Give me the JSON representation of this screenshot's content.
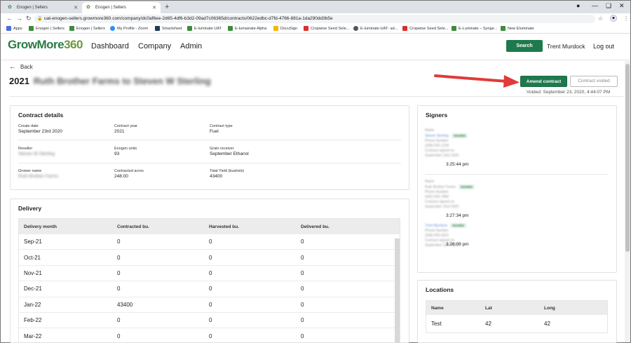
{
  "browser": {
    "tabs": [
      {
        "title": "Enogen | Sellers",
        "active": false
      },
      {
        "title": "Enogen | Sellers",
        "active": true
      }
    ],
    "new_tab": "+",
    "url": "uat-enogen-sellers.growmore360.com/company/dc0af6ee-2d65-4df6-b3d2-09ad7c06365d/contracts/0622edbc-d7fd-4766-881a-1da290dd3b5e",
    "bookmarks": [
      {
        "label": "Apps",
        "color": "#4a6ee0"
      },
      {
        "label": "Enogen | Sellers",
        "color": "#3d8b3d"
      },
      {
        "label": "Enogen | Sellers",
        "color": "#3d8b3d"
      },
      {
        "label": "My Profile - Zoom",
        "color": "#2d8cff"
      },
      {
        "label": "Smartsheet",
        "color": "#1f3b57"
      },
      {
        "label": "E-luminate UAT",
        "color": "#3d8b3d"
      },
      {
        "label": "E-lumainate Alpha",
        "color": "#3d8b3d"
      },
      {
        "label": "DocuSign",
        "color": "#f5b400"
      },
      {
        "label": "Cropwise Seed Sele...",
        "color": "#d9302c"
      },
      {
        "label": "E-luminate-UAT- ad...",
        "color": "#555555"
      },
      {
        "label": "Cropwise Seed Sele...",
        "color": "#d9302c"
      },
      {
        "label": "E-Luminate – Synge...",
        "color": "#3d8b3d"
      },
      {
        "label": "New Eluminate",
        "color": "#3d8b3d"
      }
    ]
  },
  "header": {
    "logo_text": "GrowMore",
    "logo_num": "360",
    "nav": [
      "Dashboard",
      "Company",
      "Admin"
    ],
    "search_label": "Search",
    "user_name": "Trent Murdock",
    "logout_label": "Log out"
  },
  "title_row": {
    "back_label": "Back",
    "year": "2021",
    "contract_name": "Ruth Brother Farms to Steven W Sterling",
    "amend_label": "Amend contract",
    "voided_label": "Contract voided",
    "voided_date": "Voided: September 23, 2020, 4:44:07 PM"
  },
  "contract_details": {
    "title": "Contract details",
    "fields": [
      {
        "label": "Create date",
        "value": "September 23rd 2020",
        "blurred": false
      },
      {
        "label": "Contract year",
        "value": "2021",
        "blurred": false
      },
      {
        "label": "Contract type",
        "value": "Fuel",
        "blurred": false
      },
      {
        "label": "Reseller",
        "value": "Steven W Sterling",
        "blurred": true
      },
      {
        "label": "Enogen units",
        "value": "93",
        "blurred": false
      },
      {
        "label": "Grain receiver",
        "value": "September Ethanol",
        "blurred": false
      },
      {
        "label": "Grower name",
        "value": "Ruth Brother Farms",
        "blurred": true
      },
      {
        "label": "Contracted acres",
        "value": "248.00",
        "blurred": false
      },
      {
        "label": "Total Yield (bushels)",
        "value": "43400",
        "blurred": false
      }
    ]
  },
  "delivery": {
    "title": "Delivery",
    "columns": [
      "Delivery month",
      "Contracted bu.",
      "Harvested bu.",
      "Delivered bu."
    ],
    "rows": [
      [
        "Sep-21",
        "0",
        "0",
        "0"
      ],
      [
        "Oct-21",
        "0",
        "0",
        "0"
      ],
      [
        "Nov-21",
        "0",
        "0",
        "0"
      ],
      [
        "Dec-21",
        "0",
        "0",
        "0"
      ],
      [
        "Jan-22",
        "43400",
        "0",
        "0"
      ],
      [
        "Feb-22",
        "0",
        "0",
        "0"
      ],
      [
        "Mar-22",
        "0",
        "0",
        "0"
      ]
    ]
  },
  "signers": {
    "title": "Signers",
    "entries": [
      {
        "lines": [
          "Name",
          "Steven Sterling",
          "Phone Number",
          "(308) 555-1234",
          "Contract signed on",
          "September 23rd 2020"
        ],
        "badge": "SIGNED",
        "time": "3:25:44 pm"
      },
      {
        "lines": [
          "Name",
          "Ruth Brother Farms",
          "Phone Number",
          "(402) 555-7890",
          "Contract signed on",
          "September 23rd 2020"
        ],
        "badge": "SIGNED",
        "time": "3:27:34 pm"
      },
      {
        "lines": [
          "Name",
          "Trent Murdock",
          "Phone Number",
          "(308) 555-4321",
          "Contract signed on",
          "September 23rd 2020"
        ],
        "badge": "SIGNED",
        "time": "3:26:09 pm"
      }
    ]
  },
  "locations": {
    "title": "Locations",
    "columns": [
      "Name",
      "Lat",
      "Long"
    ],
    "rows": [
      [
        "Test",
        "42",
        "42"
      ]
    ]
  },
  "colors": {
    "brand_green": "#1e7a4c",
    "arrow_red": "#e03a3a"
  }
}
